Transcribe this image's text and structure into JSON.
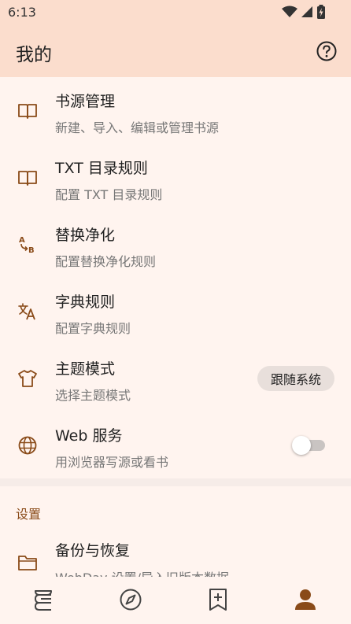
{
  "status": {
    "time": "6:13",
    "icons": [
      "wifi-icon",
      "signal-icon",
      "battery-icon"
    ]
  },
  "appbar": {
    "title": "我的",
    "help_icon": "help-icon"
  },
  "rows": [
    {
      "title": "书源管理",
      "subtitle": "新建、导入、编辑或管理书源",
      "icon": "book-open-icon"
    },
    {
      "title": "TXT 目录规则",
      "subtitle": "配置 TXT 目录规则",
      "icon": "book-open-icon"
    },
    {
      "title": "替换净化",
      "subtitle": "配置替换净化规则",
      "icon": "replace-ab-icon"
    },
    {
      "title": "字典规则",
      "subtitle": "配置字典规则",
      "icon": "translate-icon"
    },
    {
      "title": "主题模式",
      "subtitle": "选择主题模式",
      "icon": "shirt-icon",
      "value": "跟随系统"
    },
    {
      "title": "Web 服务",
      "subtitle": "用浏览器写源或看书",
      "icon": "globe-icon",
      "toggle_on": false
    }
  ],
  "settings": {
    "header": "设置",
    "item": {
      "title": "备份与恢复",
      "subtitle": "WebDav 设置/导入旧版本数据",
      "icon": "folder-icon"
    }
  },
  "bottom_nav": [
    {
      "name": "bookshelf-nav-icon",
      "active": false
    },
    {
      "name": "discover-nav-icon",
      "active": false
    },
    {
      "name": "rss-bookmark-nav-icon",
      "active": false
    },
    {
      "name": "my-nav-icon",
      "active": true
    }
  ],
  "colors": {
    "appbar": "#fbddcd",
    "background": "#fff4ef",
    "accent": "#8a4b19",
    "chip": "#e8dfdb"
  }
}
